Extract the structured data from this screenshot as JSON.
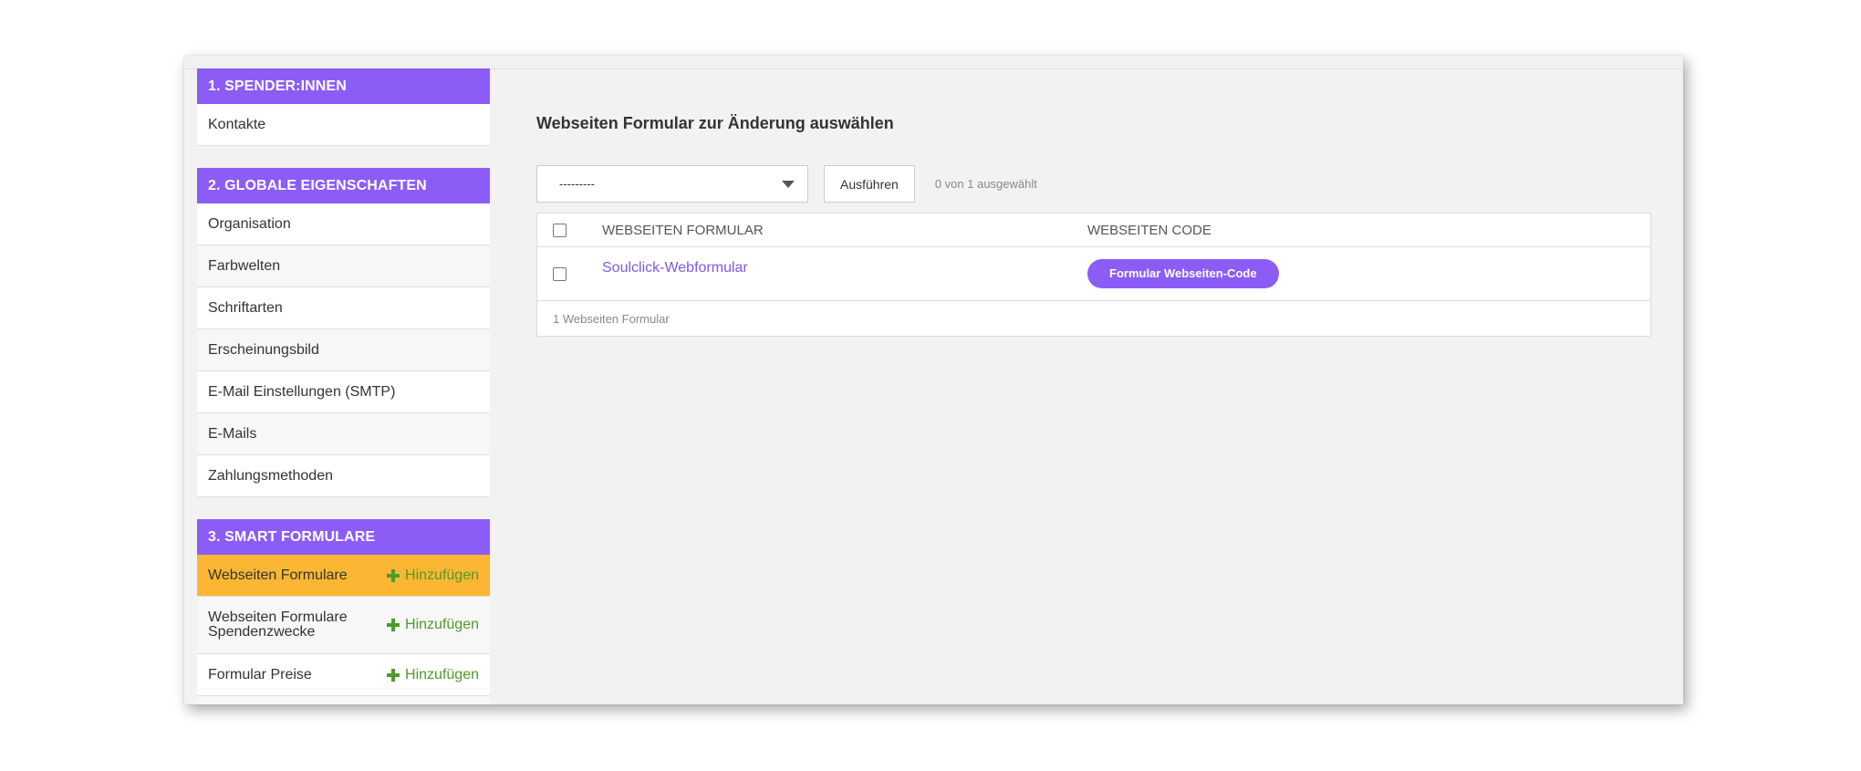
{
  "sidebar": {
    "sections": [
      {
        "header": "1. SPENDER:INNEN",
        "items": [
          {
            "label": "Kontakte"
          }
        ]
      },
      {
        "header": "2. GLOBALE EIGENSCHAFTEN",
        "items": [
          {
            "label": "Organisation"
          },
          {
            "label": "Farbwelten"
          },
          {
            "label": "Schriftarten"
          },
          {
            "label": "Erscheinungsbild"
          },
          {
            "label": "E-Mail Einstellungen (SMTP)"
          },
          {
            "label": "E-Mails"
          },
          {
            "label": "Zahlungsmethoden"
          }
        ]
      },
      {
        "header": "3. SMART FORMULARE",
        "items": [
          {
            "label": "Webseiten Formulare",
            "add_label": "Hinzufügen",
            "active": true
          },
          {
            "label": "Webseiten Formulare Spendenzwecke",
            "add_label": "Hinzufügen"
          },
          {
            "label": "Formular Preise",
            "add_label": "Hinzufügen"
          }
        ]
      }
    ]
  },
  "main": {
    "title": "Webseiten Formular zur Änderung auswählen",
    "action_select": {
      "value": "---------"
    },
    "run_button": "Ausführen",
    "selection_count": "0 von 1 ausgewählt",
    "table": {
      "columns": [
        "WEBSEITEN FORMULAR",
        "WEBSEITEN CODE"
      ],
      "rows": [
        {
          "name": "Soulclick-Webformular",
          "code_button": "Formular Webseiten-Code"
        }
      ],
      "footer": "1 Webseiten Formular"
    }
  },
  "colors": {
    "accent_purple": "#8b5cf6",
    "active_item": "#fbb733",
    "add_green": "#4e9a2a",
    "link_purple": "#7c5ae8"
  }
}
